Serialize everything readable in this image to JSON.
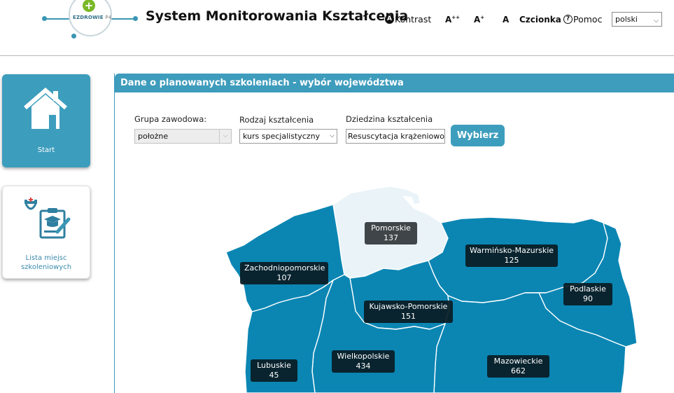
{
  "header": {
    "logo_text": "EZDROWIE",
    "logo_suffix": "P4",
    "title": "System Monitorowania Kształcenia",
    "kontrast_label": "Kontrast",
    "font_large": "A",
    "font_medium": "A",
    "font_small": "A",
    "czcionka_label": "Czcionka",
    "pomoc_label": "Pomoc",
    "language": "polski"
  },
  "sidebar": {
    "items": [
      {
        "label": "Start",
        "icon": "home-icon"
      },
      {
        "label": "Lista miejsc szkoleniowych",
        "icon": "clipboard-icon"
      }
    ]
  },
  "panel": {
    "title": "Dane o planowanych szkoleniach - wybór województwa",
    "filters": {
      "grupa_label": "Grupa zawodowa:",
      "grupa_value": "położne",
      "rodzaj_label": "Rodzaj kształcenia",
      "rodzaj_value": "kurs specjalistyczny",
      "dziedzina_label": "Dziedzina kształcenia",
      "dziedzina_value": "Resuscytacja krążeniowo-oddechowa"
    },
    "submit_label": "Wybierz"
  },
  "map": {
    "colors": {
      "region": "#0b86b3",
      "selected": "#e9f3f8",
      "border": "#ffffff"
    },
    "regions": [
      {
        "name": "Pomorskie",
        "value": "137"
      },
      {
        "name": "Warmińsko-Mazurskie",
        "value": "125"
      },
      {
        "name": "Zachodniopomorskie",
        "value": "107"
      },
      {
        "name": "Podlaskie",
        "value": "90"
      },
      {
        "name": "Kujawsko-Pomorskie",
        "value": "151"
      },
      {
        "name": "Lubuskie",
        "value": "45"
      },
      {
        "name": "Wielkopolskie",
        "value": "434"
      },
      {
        "name": "Mazowieckie",
        "value": "662"
      }
    ]
  }
}
